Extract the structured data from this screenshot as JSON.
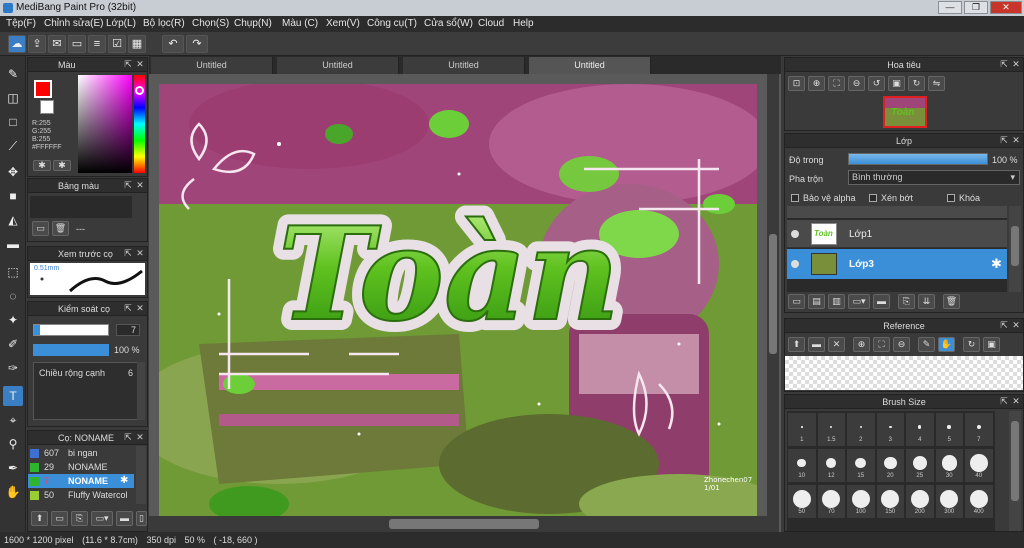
{
  "window": {
    "title": "MediBang Paint Pro (32bit)",
    "minimize": "—",
    "maximize": "❐",
    "close": "✕"
  },
  "menu": [
    "Tệp(F)",
    "Chỉnh sửa(E)",
    "Lớp(L)",
    "Bộ lọc(R)",
    "Chọn(S)",
    "Chụp(N)",
    "Màu (C)",
    "Xem(V)",
    "Công cụ(T)",
    "Cửa sổ(W)",
    "Cloud",
    "Help"
  ],
  "tabs": [
    "Untitled",
    "Untitled",
    "Untitled",
    "Untitled"
  ],
  "color_panel": {
    "title": "Màu",
    "r": "R:255",
    "g": "G:255",
    "b": "B:255",
    "hex": "#FFFFFF"
  },
  "palette_panel": {
    "title": "Bảng màu",
    "dashes": "---"
  },
  "preview_panel": {
    "title": "Xem trước cọ",
    "size": "0.51mm"
  },
  "brush_control": {
    "title": "Kiểm soát cọ",
    "size": "7",
    "opacity": "100 %",
    "width_label": "Chiều rộng cạnh",
    "width_val": "6"
  },
  "brush_list": {
    "title": "Cọ: NONAME",
    "items": [
      {
        "size": "607",
        "name": "bi ngan",
        "color": "#3f6fd0"
      },
      {
        "size": "29",
        "name": "NONAME",
        "color": "#2fb42f"
      },
      {
        "size": "7",
        "name": "NONAME",
        "color": "#2fb42f"
      },
      {
        "size": "50",
        "name": "Fluffy Watercol",
        "color": "#9acd32"
      }
    ]
  },
  "navigator": {
    "title": "Hoa tiêu"
  },
  "layer_panel": {
    "title": "Lớp",
    "opacity_label": "Độ trong",
    "opacity_val": "100 %",
    "opacity_fraction": 1.0,
    "blend_label": "Pha trộn",
    "blend_val": "Bình thường",
    "protect_alpha": "Bảo vệ alpha",
    "clipping": "Xén bớt",
    "lock": "Khóa",
    "layers": [
      {
        "name": "Lớp1"
      },
      {
        "name": "Lớp3"
      }
    ]
  },
  "reference_panel": {
    "title": "Reference"
  },
  "brush_size_panel": {
    "title": "Brush Size",
    "row1": [
      "1",
      "1.5",
      "2",
      "3",
      "4",
      "5",
      "7"
    ],
    "row2": [
      "10",
      "12",
      "15",
      "20",
      "25",
      "30",
      "40"
    ],
    "row3": [
      "50",
      "70",
      "100",
      "150",
      "200",
      "300",
      "400"
    ]
  },
  "canvas": {
    "artwork_text": "Toàn",
    "signature_line1": "Zhonechen07",
    "signature_line2": "1/01"
  },
  "status": {
    "size": "1600 * 1200 pixel",
    "dims": "(11.6 * 8.7cm)",
    "dpi": "350 dpi",
    "zoom": "50 %",
    "coords": "( -18, 660 )"
  },
  "colors": {
    "accent": "#3a8fd8",
    "primary": "#ff0000"
  }
}
